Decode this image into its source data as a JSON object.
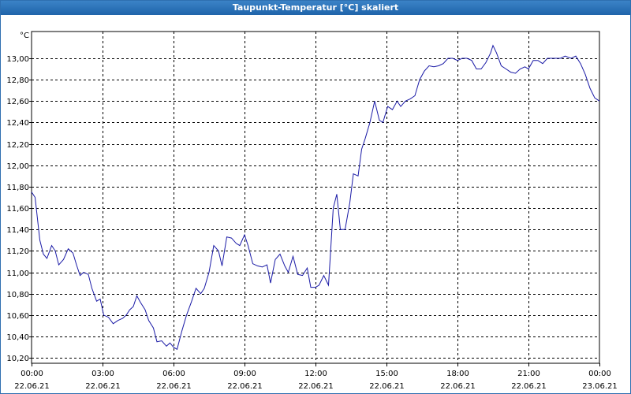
{
  "window": {
    "title": "Taupunkt-Temperatur [°C] skaliert"
  },
  "chart_data": {
    "type": "line",
    "title": "Taupunkt-Temperatur [°C] skaliert",
    "ylabel": "°C",
    "xlabel": "",
    "ylim": [
      10.15,
      13.25
    ],
    "yticks": [
      "13,00",
      "12,80",
      "12,60",
      "12,40",
      "12,20",
      "12,00",
      "11,80",
      "11,60",
      "11,40",
      "11,20",
      "11,00",
      "10,80",
      "10,60",
      "10,40",
      "10,20"
    ],
    "ytick_values": [
      13.0,
      12.8,
      12.6,
      12.4,
      12.2,
      12.0,
      11.8,
      11.6,
      11.4,
      11.2,
      11.0,
      10.8,
      10.6,
      10.4,
      10.2
    ],
    "xticks": [
      {
        "time": "00:00",
        "date": "22.06.21"
      },
      {
        "time": "03:00",
        "date": "22.06.21"
      },
      {
        "time": "06:00",
        "date": "22.06.21"
      },
      {
        "time": "09:00",
        "date": "22.06.21"
      },
      {
        "time": "12:00",
        "date": "22.06.21"
      },
      {
        "time": "15:00",
        "date": "22.06.21"
      },
      {
        "time": "18:00",
        "date": "22.06.21"
      },
      {
        "time": "21:00",
        "date": "22.06.21"
      },
      {
        "time": "00:00",
        "date": "23.06.21"
      }
    ],
    "xlim_hours": [
      0,
      24
    ],
    "grid": true,
    "line_color": "#1a1aa6",
    "x_hours": [
      0,
      0.15,
      0.35,
      0.5,
      0.65,
      0.85,
      1.0,
      1.15,
      1.35,
      1.55,
      1.75,
      1.9,
      2.05,
      2.2,
      2.4,
      2.55,
      2.75,
      2.9,
      3.05,
      3.25,
      3.45,
      3.65,
      3.85,
      4.0,
      4.15,
      4.3,
      4.45,
      4.6,
      4.8,
      4.95,
      5.15,
      5.3,
      5.5,
      5.7,
      5.85,
      6.0,
      6.15,
      6.35,
      6.55,
      6.75,
      6.95,
      7.15,
      7.3,
      7.5,
      7.7,
      7.9,
      8.05,
      8.25,
      8.45,
      8.65,
      8.8,
      9.0,
      9.15,
      9.35,
      9.55,
      9.75,
      9.95,
      10.1,
      10.3,
      10.5,
      10.7,
      10.85,
      11.05,
      11.25,
      11.45,
      11.65,
      11.8,
      12.0,
      12.15,
      12.35,
      12.55,
      12.75,
      12.9,
      13.05,
      13.25,
      13.45,
      13.6,
      13.8,
      13.95,
      14.1,
      14.3,
      14.5,
      14.7,
      14.85,
      15.05,
      15.25,
      15.45,
      15.6,
      15.8,
      16.0,
      16.2,
      16.4,
      16.6,
      16.8,
      17.0,
      17.2,
      17.4,
      17.6,
      17.8,
      18.0,
      18.2,
      18.4,
      18.6,
      18.8,
      19.0,
      19.2,
      19.4,
      19.5,
      19.65,
      19.85,
      20.05,
      20.25,
      20.45,
      20.65,
      20.85,
      21.0,
      21.2,
      21.4,
      21.6,
      21.8,
      22.0,
      22.15,
      22.35,
      22.55,
      22.8,
      23.0,
      23.2,
      23.4,
      23.6,
      23.8,
      24.0
    ],
    "values": [
      11.75,
      11.7,
      11.3,
      11.17,
      11.13,
      11.25,
      11.2,
      11.07,
      11.12,
      11.22,
      11.18,
      11.07,
      10.97,
      11.0,
      10.98,
      10.85,
      10.73,
      10.75,
      10.6,
      10.58,
      10.52,
      10.55,
      10.57,
      10.6,
      10.65,
      10.68,
      10.78,
      10.72,
      10.65,
      10.55,
      10.48,
      10.35,
      10.36,
      10.31,
      10.34,
      10.3,
      10.28,
      10.45,
      10.6,
      10.72,
      10.85,
      10.8,
      10.85,
      11.0,
      11.25,
      11.2,
      11.06,
      11.33,
      11.32,
      11.27,
      11.25,
      11.35,
      11.25,
      11.08,
      11.06,
      11.05,
      11.07,
      10.9,
      11.12,
      11.17,
      11.06,
      11.0,
      11.15,
      10.98,
      10.97,
      11.04,
      10.86,
      10.86,
      10.88,
      10.97,
      10.88,
      11.6,
      11.73,
      11.4,
      11.4,
      11.65,
      11.92,
      11.9,
      12.15,
      12.25,
      12.4,
      12.6,
      12.42,
      12.4,
      12.55,
      12.52,
      12.6,
      12.55,
      12.6,
      12.62,
      12.65,
      12.8,
      12.88,
      12.93,
      12.92,
      12.93,
      12.95,
      13.0,
      13.0,
      12.98,
      13.0,
      13.0,
      12.98,
      12.9,
      12.9,
      12.96,
      13.05,
      13.12,
      13.05,
      12.93,
      12.9,
      12.87,
      12.86,
      12.9,
      12.92,
      12.9,
      12.98,
      12.98,
      12.95,
      13.0,
      13.0,
      13.0,
      13.0,
      13.02,
      13.0,
      13.02,
      12.95,
      12.85,
      12.72,
      12.63,
      12.6
    ]
  }
}
